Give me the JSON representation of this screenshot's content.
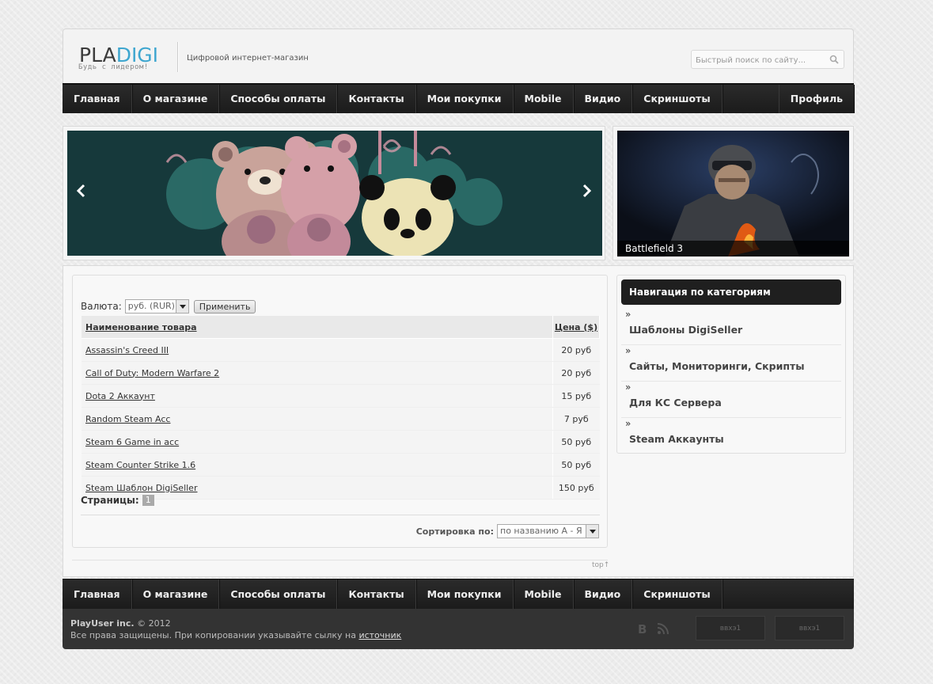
{
  "header": {
    "logo_part1": "PLA",
    "logo_part2": "DIGI",
    "logo_slogan": "Будь с лидером!",
    "tagline": "Цифровой интернет-магазин",
    "search_placeholder": "Быстрый поиск по сайту..."
  },
  "nav": {
    "items": [
      "Главная",
      "О магазине",
      "Способы оплаты",
      "Контакты",
      "Мои покупки",
      "Mobile",
      "Видио",
      "Скриншоты"
    ],
    "profile": "Профиль"
  },
  "slider": {
    "prev_icon": "arrow-left-icon",
    "next_icon": "arrow-right-icon"
  },
  "featured": {
    "caption": "Battlefield 3"
  },
  "shop": {
    "currency_label": "Валюта:",
    "currency_value": "руб. (RUR)",
    "apply_label": "Применить",
    "col_name": "Наименование товара",
    "col_price": "Цена ($)",
    "rows": [
      {
        "name": "Assassin's Creed III",
        "price": "20 руб"
      },
      {
        "name": "Call of Duty: Modern Warfare 2",
        "price": "20 руб"
      },
      {
        "name": "Dota 2 Аккаунт",
        "price": "15 руб"
      },
      {
        "name": "Random Steam Acc",
        "price": "7 руб"
      },
      {
        "name": "Steam 6 Game in acc",
        "price": "50 руб"
      },
      {
        "name": "Steam Counter Strike 1.6",
        "price": "50 руб"
      },
      {
        "name": "Steam Шаблон DigiSeller",
        "price": "150 руб"
      }
    ],
    "pages_label": "Страницы:",
    "current_page": "1",
    "sort_label": "Сортировка по:",
    "sort_value": "по названию А - Я",
    "top_link": "top↑"
  },
  "categories": {
    "title": "Навигация по категориям",
    "items": [
      "Шаблоны DigiSeller",
      "Сайты, Мониторинги, Скрипты",
      "Для КС Сервера",
      "Steam Аккаунты"
    ]
  },
  "footer": {
    "company": "PlayUser inc.",
    "year": "© 2012",
    "rights": "Все права защищены. При копировании указывайте сылку на",
    "source_link": "источник",
    "badge1": "ввхэ1",
    "badge2": "ввхэ1"
  },
  "colors": {
    "accent": "#3ea6cf",
    "nav_bg": "#222222",
    "footer_bg": "#333333"
  }
}
